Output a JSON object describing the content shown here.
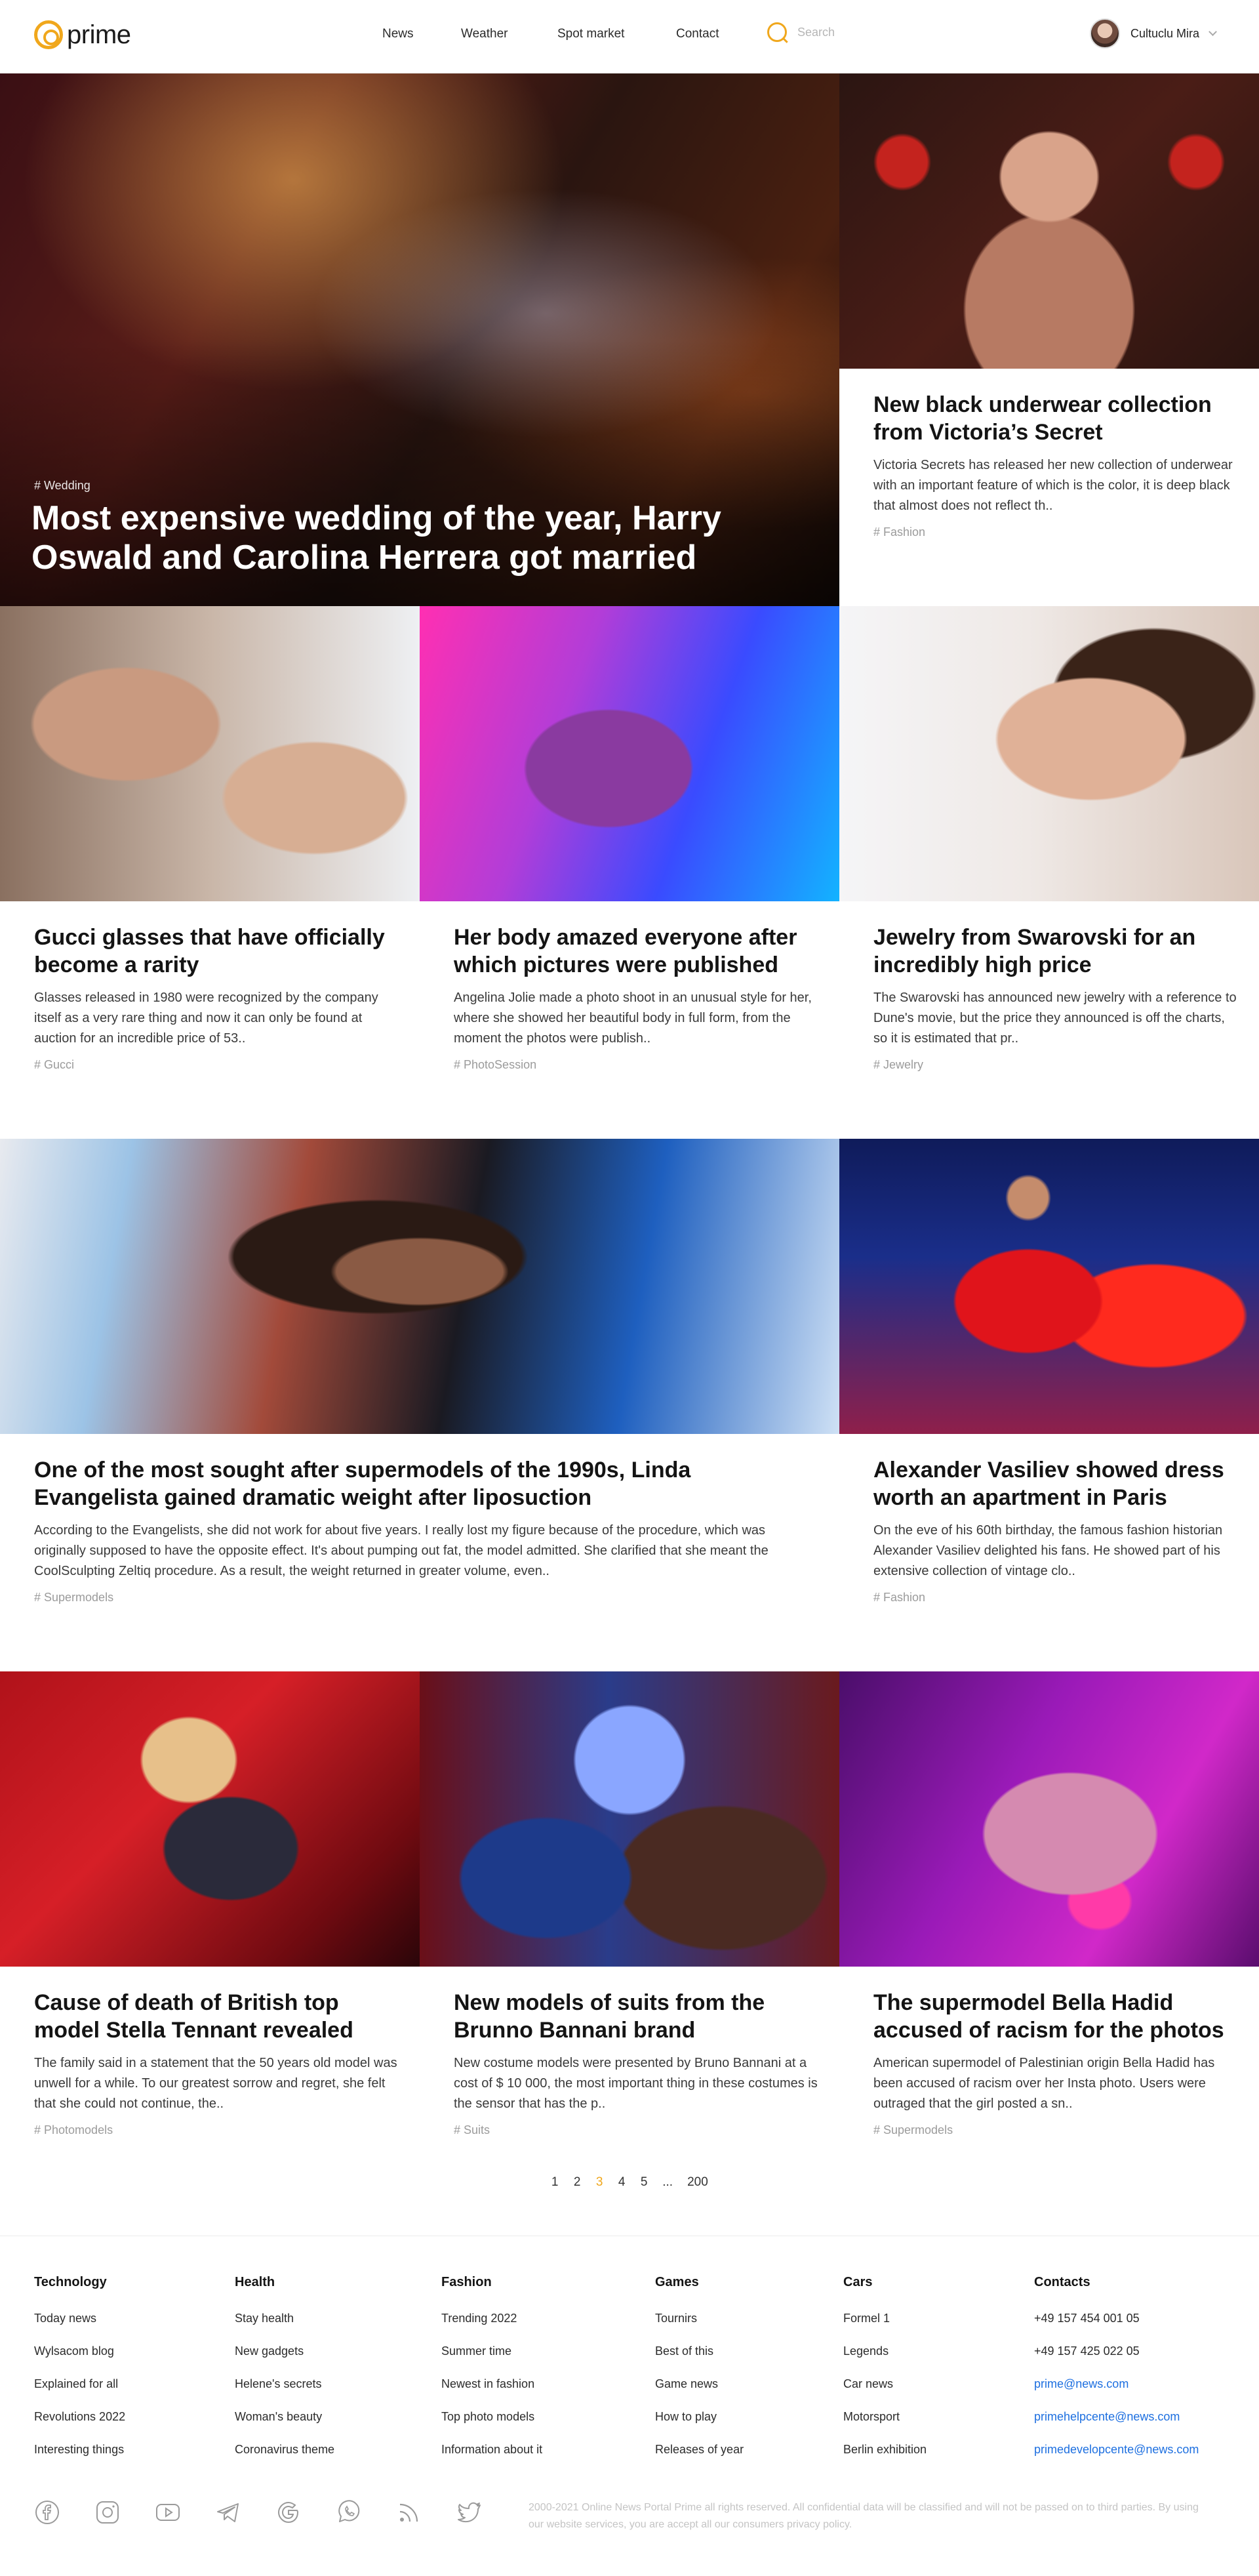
{
  "app": {
    "logo_text": "prime"
  },
  "nav": {
    "items": [
      {
        "label": "News"
      },
      {
        "label": "Weather"
      },
      {
        "label": "Spot market"
      },
      {
        "label": "Contact"
      }
    ],
    "search_placeholder": "Search"
  },
  "user": {
    "name": "Cultuclu Mira"
  },
  "hero": {
    "tag": "# Wedding",
    "title": "Most expensive wedding of the year, Harry Oswald and Carolina Herrera got married"
  },
  "articles": [
    {
      "title": "New black underwear collection from Victoria’s Secret",
      "excerpt": "Victoria Secrets has released her new collection of underwear with an important feature of which is the color, it is deep black that almost does not reflect th..",
      "tag": "# Fashion"
    },
    {
      "title": "Gucci glasses that have officially become a rarity",
      "excerpt": "Glasses released in 1980 were recognized by the company itself as a very rare thing and now it can only be found at auction for an incredible price of 53..",
      "tag": "# Gucci"
    },
    {
      "title": "Her body amazed everyone after which pictures were published",
      "excerpt": "Angelina Jolie made a photo shoot in an unusual style for her, where she showed her beautiful body in full form, from the moment the photos were publish..",
      "tag": "# PhotoSession"
    },
    {
      "title": "Jewelry from Swarovski for an incredibly high price",
      "excerpt": "The Swarovski has announced new jewelry with a reference to Dune's movie, but the price they announced is off the charts, so it is estimated that pr..",
      "tag": "# Jewelry"
    },
    {
      "title": "One of the most sought after supermodels of the 1990s, Linda Evangelista gained dramatic weight after liposuction",
      "excerpt": "According to the Evangelists, she did not work for about five years. I really lost my figure because of the procedure, which was originally supposed to have the opposite effect. It's about pumping out fat, the model admitted. She clarified that she meant the CoolSculpting Zeltiq procedure. As a result, the weight returned in greater volume, even..",
      "tag": "# Supermodels"
    },
    {
      "title": "Alexander Vasiliev showed dress worth an apartment in Paris",
      "excerpt": "On the eve of his 60th birthday, the famous fashion historian Alexander Vasiliev delighted his fans. He showed part of his extensive collection of vintage clo..",
      "tag": "# Fashion"
    },
    {
      "title": "Cause of death of British top model Stella Tennant revealed",
      "excerpt": "The family said in a statement that the 50 years old model was unwell for a while. To our greatest sorrow and regret, she felt that she could not continue, the..",
      "tag": "# Photomodels"
    },
    {
      "title": "New models of suits from the Brunno Bannani brand",
      "excerpt": "New costume models were presented by Bruno Bannani at a cost of $ 10 000, the most important thing in these costumes is the sensor that has the p..",
      "tag": "# Suits"
    },
    {
      "title": "The supermodel Bella Hadid accused of racism for the photos",
      "excerpt": "American supermodel of Palestinian origin Bella Hadid has been accused of racism over her Insta photo. Users were outraged that the girl posted a sn..",
      "tag": "# Supermodels"
    }
  ],
  "pagination": {
    "pages": [
      "1",
      "2",
      "3",
      "4",
      "5",
      "...",
      "200"
    ],
    "current": "3"
  },
  "footer": {
    "columns": [
      {
        "heading": "Technology",
        "links": [
          "Today news",
          "Wylsacom blog",
          "Explained for all",
          "Revolutions 2022",
          "Interesting things"
        ]
      },
      {
        "heading": "Health",
        "links": [
          "Stay health",
          "New gadgets",
          "Helene's secrets",
          "Woman's beauty",
          "Coronavirus theme"
        ]
      },
      {
        "heading": "Fashion",
        "links": [
          "Trending 2022",
          "Summer time",
          "Newest in fashion",
          "Top photo models",
          "Information about it"
        ]
      },
      {
        "heading": "Games",
        "links": [
          "Tournirs",
          "Best of this",
          "Game news",
          "How to play",
          "Releases of year"
        ]
      },
      {
        "heading": "Cars",
        "links": [
          "Formel 1",
          "Legends",
          "Car news",
          "Motorsport",
          "Berlin exhibition"
        ]
      },
      {
        "heading": "Contacts",
        "links": [
          "+49 157 454 001 05",
          "+49 157 425 022 05",
          "prime@news.com",
          "primehelpcente@news.com",
          "primedevelopcente@news.com"
        ]
      }
    ],
    "social_icons": [
      "facebook-icon",
      "instagram-icon",
      "youtube-icon",
      "telegram-icon",
      "google-icon",
      "whatsapp-icon",
      "rss-icon",
      "twitter-icon"
    ],
    "copyright": "2000-2021 Online News Portal Prime all rights reserved. All confidential data will be classified and will not be passed on to third parties. By using our website services, you are accept all our consumers privacy policy."
  },
  "colors": {
    "accent": "#f0a71c",
    "link": "#1d6fe0",
    "muted": "#9b9b9b"
  }
}
